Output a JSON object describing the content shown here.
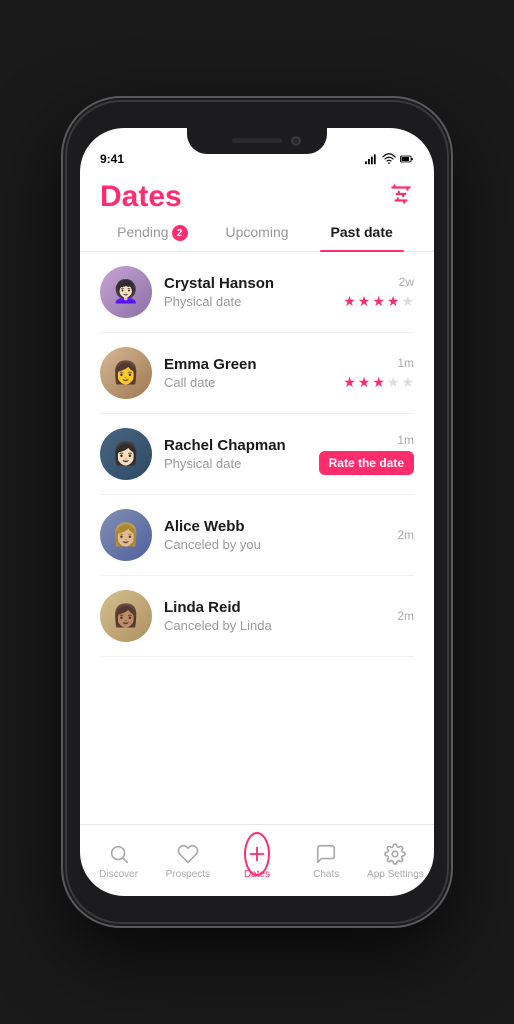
{
  "header": {
    "title": "Dates",
    "filter_label": "filter-icon"
  },
  "tabs": [
    {
      "id": "pending",
      "label": "Pending",
      "badge": "2",
      "active": false
    },
    {
      "id": "upcoming",
      "label": "Upcoming",
      "badge": null,
      "active": false
    },
    {
      "id": "past",
      "label": "Past date",
      "badge": null,
      "active": true
    }
  ],
  "dates": [
    {
      "id": 1,
      "name": "Crystal Hanson",
      "type": "Physical date",
      "time": "2w",
      "rating": 4,
      "max_rating": 5,
      "status": "rated",
      "avatar_class": "av1",
      "avatar_emoji": "👩"
    },
    {
      "id": 2,
      "name": "Emma Green",
      "type": "Call date",
      "time": "1m",
      "rating": 3,
      "max_rating": 5,
      "status": "rated",
      "avatar_class": "av2",
      "avatar_emoji": "👩"
    },
    {
      "id": 3,
      "name": "Rachel Chapman",
      "type": "Physical date",
      "time": "1m",
      "rating": 0,
      "max_rating": 5,
      "status": "rate",
      "rate_label": "Rate the date",
      "avatar_class": "av3",
      "avatar_emoji": "👩"
    },
    {
      "id": 4,
      "name": "Alice Webb",
      "type": "Canceled by you",
      "time": "2m",
      "rating": 0,
      "max_rating": 0,
      "status": "canceled",
      "avatar_class": "av4",
      "avatar_emoji": "👩"
    },
    {
      "id": 5,
      "name": "Linda Reid",
      "type": "Canceled by Linda",
      "time": "2m",
      "rating": 0,
      "max_rating": 0,
      "status": "canceled",
      "avatar_class": "av5",
      "avatar_emoji": "👩"
    }
  ],
  "bottom_nav": [
    {
      "id": "discover",
      "label": "Discover",
      "icon": "search",
      "active": false
    },
    {
      "id": "prospects",
      "label": "Prospects",
      "icon": "heart",
      "active": false
    },
    {
      "id": "dates",
      "label": "Dates",
      "icon": "plus-circle",
      "active": true
    },
    {
      "id": "chats",
      "label": "Chats",
      "icon": "chat",
      "active": false
    },
    {
      "id": "settings",
      "label": "App Settings",
      "icon": "gear",
      "active": false
    }
  ]
}
